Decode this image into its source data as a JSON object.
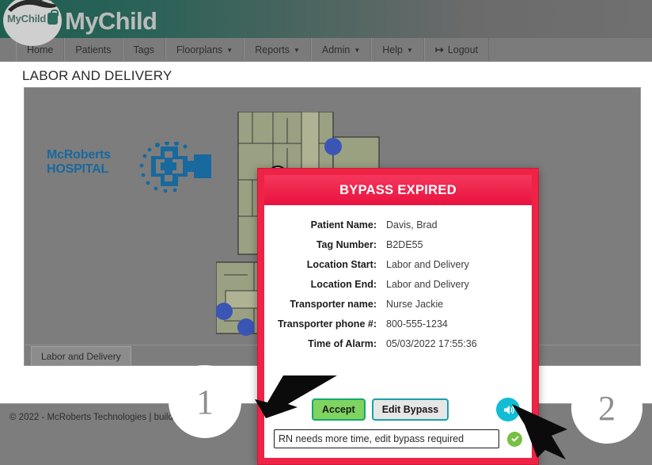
{
  "header": {
    "brand_title": "MyChild",
    "logo_badge_text": "MyChild",
    "logo_name": "mychild-stork-logo"
  },
  "nav": {
    "items": [
      {
        "label": "Home",
        "has_caret": false,
        "icon": ""
      },
      {
        "label": "Patients",
        "has_caret": false,
        "icon": ""
      },
      {
        "label": "Tags",
        "has_caret": false,
        "icon": ""
      },
      {
        "label": "Floorplans",
        "has_caret": true,
        "icon": ""
      },
      {
        "label": "Reports",
        "has_caret": true,
        "icon": ""
      },
      {
        "label": "Admin",
        "has_caret": true,
        "icon": ""
      },
      {
        "label": "Help",
        "has_caret": true,
        "icon": ""
      },
      {
        "label": "Logout",
        "has_caret": false,
        "icon": "logout-icon"
      }
    ],
    "caret_glyph": "▼",
    "logout_glyph": "↦"
  },
  "page": {
    "title": "LABOR AND DELIVERY",
    "hospital_logo_line1": "McRoberts",
    "hospital_logo_line2": "HOSPITAL",
    "floorplan_tab": "Labor and Delivery",
    "footer": "© 2022 - McRoberts Technologies | build"
  },
  "modal": {
    "title": "BYPASS EXPIRED",
    "fields": [
      {
        "label": "Patient Name:",
        "value": "Davis, Brad"
      },
      {
        "label": "Tag Number:",
        "value": "B2DE55"
      },
      {
        "label": "Location Start:",
        "value": "Labor and Delivery"
      },
      {
        "label": "Location End:",
        "value": "Labor and Delivery"
      },
      {
        "label": "Transporter name:",
        "value": "Nurse Jackie"
      },
      {
        "label": "Transporter phone #:",
        "value": "800-555-1234"
      },
      {
        "label": "Time of Alarm:",
        "value": "05/03/2022 17:55:36"
      }
    ],
    "accept_label": "Accept",
    "edit_bypass_label": "Edit Bypass",
    "speaker_icon": "speaker-icon",
    "note_value": "RN needs more time, edit bypass required",
    "note_placeholder": "",
    "check_icon": "check-circle-icon",
    "colors": {
      "modal_border": "#EE2346",
      "header_red": "#E9123F",
      "accept_green": "#7FD35F",
      "accept_border": "#14A86E",
      "edit_border": "#1B9FA8",
      "speaker_cyan": "#12BCD4",
      "check_green": "#76C043"
    }
  },
  "annotations": {
    "callouts": [
      {
        "number": "1"
      },
      {
        "number": "2"
      }
    ],
    "arrows": [
      {
        "name": "arrow-pointing-accept-button"
      },
      {
        "name": "arrow-pointing-check-badge"
      }
    ]
  },
  "floorplan": {
    "name": "labor-and-delivery-floorplan",
    "access_points": 4,
    "tags": 6
  }
}
